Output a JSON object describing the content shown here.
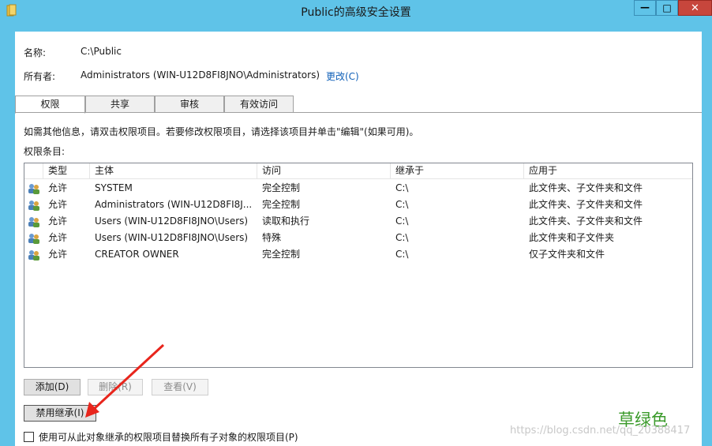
{
  "window": {
    "title": "Public的高级安全设置",
    "controls": {
      "minimize": "—",
      "maximize": "□",
      "close": "✕"
    },
    "icon": "folder-icon"
  },
  "info": {
    "name_label": "名称:",
    "name_value": "C:\\Public",
    "owner_label": "所有者:",
    "owner_value": "Administrators (WIN-U12D8FI8JNO\\Administrators)",
    "change_link": "更改(C)"
  },
  "tabs": [
    {
      "label": "权限",
      "active": true
    },
    {
      "label": "共享",
      "active": false
    },
    {
      "label": "审核",
      "active": false
    },
    {
      "label": "有效访问",
      "active": false
    }
  ],
  "permissions": {
    "hint": "如需其他信息，请双击权限项目。若要修改权限项目，请选择该项目并单击\"编辑\"(如果可用)。",
    "entries_label": "权限条目:",
    "columns": [
      "类型",
      "主体",
      "访问",
      "继承于",
      "应用于"
    ],
    "rows": [
      {
        "type": "允许",
        "principal": "SYSTEM",
        "access": "完全控制",
        "inherited": "C:\\",
        "applies": "此文件夹、子文件夹和文件"
      },
      {
        "type": "允许",
        "principal": "Administrators (WIN-U12D8FI8J...",
        "access": "完全控制",
        "inherited": "C:\\",
        "applies": "此文件夹、子文件夹和文件"
      },
      {
        "type": "允许",
        "principal": "Users (WIN-U12D8FI8JNO\\Users)",
        "access": "读取和执行",
        "inherited": "C:\\",
        "applies": "此文件夹、子文件夹和文件"
      },
      {
        "type": "允许",
        "principal": "Users (WIN-U12D8FI8JNO\\Users)",
        "access": "特殊",
        "inherited": "C:\\",
        "applies": "此文件夹和子文件夹"
      },
      {
        "type": "允许",
        "principal": "CREATOR OWNER",
        "access": "完全控制",
        "inherited": "C:\\",
        "applies": "仅子文件夹和文件"
      }
    ]
  },
  "buttons": {
    "add": "添加(D)",
    "remove": "删除(R)",
    "view": "查看(V)",
    "disable_inheritance": "禁用继承(I)"
  },
  "checkbox": {
    "label": "使用可从此对象继承的权限项目替换所有子对象的权限项目(P)",
    "checked": false
  },
  "overlay": {
    "annotation_text": "草绿色",
    "watermark": "https://blog.csdn.net/qq_20388417"
  },
  "colors": {
    "titlebar": "#5fc3e8",
    "close": "#c7463c",
    "link": "#1060b8",
    "annotation": "#3a9a2a",
    "arrow": "#e8251c"
  }
}
